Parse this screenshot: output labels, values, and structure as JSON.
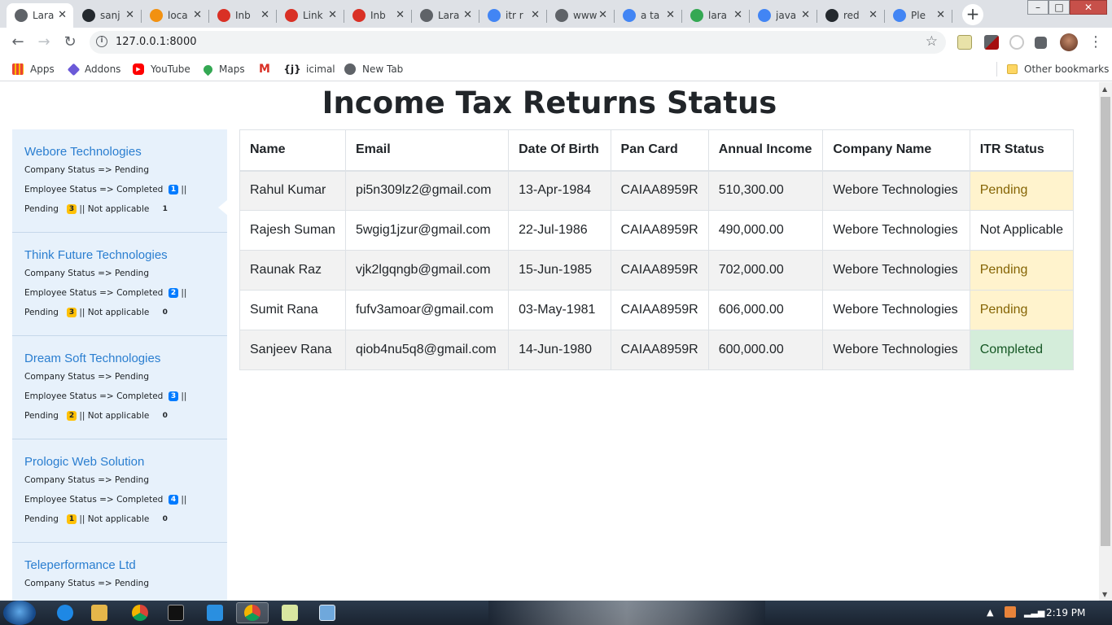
{
  "browser": {
    "tabs": [
      {
        "title": "Lara",
        "icon": "globe-icon",
        "color": "#5f6368",
        "active": true
      },
      {
        "title": "sanj",
        "icon": "github-icon",
        "color": "#24292e"
      },
      {
        "title": "loca",
        "icon": "phpmyadmin-icon",
        "color": "#f29111"
      },
      {
        "title": "Inb",
        "icon": "gmail-icon",
        "color": "#d93025"
      },
      {
        "title": "Link",
        "icon": "gmail-icon",
        "color": "#d93025"
      },
      {
        "title": "Inb",
        "icon": "gmail-icon",
        "color": "#d93025"
      },
      {
        "title": "Lara",
        "icon": "globe-icon",
        "color": "#5f6368"
      },
      {
        "title": "itr r",
        "icon": "google-icon",
        "color": "#4285f4"
      },
      {
        "title": "www",
        "icon": "globe-icon",
        "color": "#5f6368"
      },
      {
        "title": "a ta",
        "icon": "google-icon",
        "color": "#4285f4"
      },
      {
        "title": "lara",
        "icon": "star-icon",
        "color": "#34a853"
      },
      {
        "title": "java",
        "icon": "google-icon",
        "color": "#4285f4"
      },
      {
        "title": "red",
        "icon": "github-icon",
        "color": "#24292e"
      },
      {
        "title": "Ple",
        "icon": "google-icon",
        "color": "#4285f4"
      }
    ],
    "url": "127.0.0.1:8000",
    "bookmarks": [
      {
        "label": "Apps",
        "icon": "apps-grid-icon"
      },
      {
        "label": "Addons",
        "icon": "addons-icon"
      },
      {
        "label": "YouTube",
        "icon": "youtube-icon"
      },
      {
        "label": "Maps",
        "icon": "maps-pin-icon"
      },
      {
        "label": "",
        "icon": "gmail-icon"
      },
      {
        "label": "icimal",
        "icon": "json-braces-icon"
      },
      {
        "label": "New Tab",
        "icon": "globe-icon"
      }
    ],
    "other_bookmarks": "Other bookmarks"
  },
  "page": {
    "title": "Income Tax Returns Status",
    "companies": [
      {
        "name": "Webore Technologies",
        "company_status_label": "Company Status => Pending",
        "employee_status_label": "Employee Status => Completed",
        "completed": "1",
        "pending_label": "Pending",
        "pending": "3",
        "not_applicable_label": "|| Not applicable",
        "not_applicable": "1"
      },
      {
        "name": "Think Future Technologies",
        "company_status_label": "Company Status => Pending",
        "employee_status_label": "Employee Status => Completed",
        "completed": "2",
        "pending_label": "Pending",
        "pending": "3",
        "not_applicable_label": "|| Not applicable",
        "not_applicable": "0"
      },
      {
        "name": "Dream Soft Technologies",
        "company_status_label": "Company Status => Pending",
        "employee_status_label": "Employee Status => Completed",
        "completed": "3",
        "pending_label": "Pending",
        "pending": "2",
        "not_applicable_label": "|| Not applicable",
        "not_applicable": "0"
      },
      {
        "name": "Prologic Web Solution",
        "company_status_label": "Company Status => Pending",
        "employee_status_label": "Employee Status => Completed",
        "completed": "4",
        "pending_label": "Pending",
        "pending": "1",
        "not_applicable_label": "|| Not applicable",
        "not_applicable": "0"
      },
      {
        "name": "Teleperformance Ltd",
        "company_status_label": "Company Status => Pending"
      }
    ],
    "table": {
      "headers": [
        "Name",
        "Email",
        "Date Of Birth",
        "Pan Card",
        "Annual Income",
        "Company Name",
        "ITR Status"
      ],
      "rows": [
        [
          "Rahul Kumar",
          "pi5n309lz2@gmail.com",
          "13-Apr-1984",
          "CAIAA8959R",
          "510,300.00",
          "Webore Technologies",
          "Pending"
        ],
        [
          "Rajesh Suman",
          "5wgig1jzur@gmail.com",
          "22-Jul-1986",
          "CAIAA8959R",
          "490,000.00",
          "Webore Technologies",
          "Not Applicable"
        ],
        [
          "Raunak Raz",
          "vjk2lgqngb@gmail.com",
          "15-Jun-1985",
          "CAIAA8959R",
          "702,000.00",
          "Webore Technologies",
          "Pending"
        ],
        [
          "Sumit Rana",
          "fufv3amoar@gmail.com",
          "03-May-1981",
          "CAIAA8959R",
          "606,000.00",
          "Webore Technologies",
          "Pending"
        ],
        [
          "Sanjeev Rana",
          "qiob4nu5q8@gmail.com",
          "14-Jun-1980",
          "CAIAA8959R",
          "600,000.00",
          "Webore Technologies",
          "Completed"
        ]
      ]
    }
  },
  "taskbar": {
    "clock": "2:19 PM"
  },
  "colors": {
    "pending_bg": "#fff3cd",
    "completed_bg": "#d4edda",
    "sidebar_bg": "#e7f1fb",
    "link": "#2a7ed0"
  }
}
